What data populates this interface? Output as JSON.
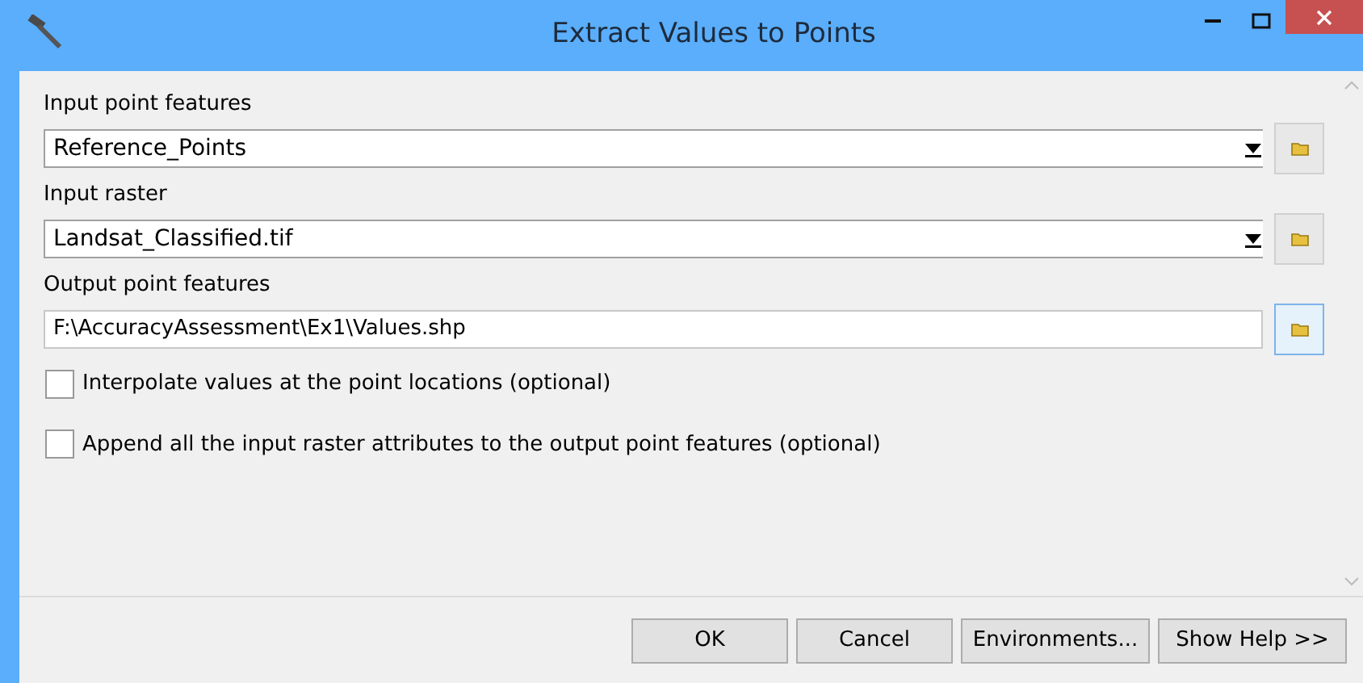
{
  "window": {
    "title": "Extract Values to Points"
  },
  "parameters": [
    {
      "label": "Input point features",
      "kind": "dropdown",
      "value": "Reference_Points",
      "focused": false
    },
    {
      "label": "Input raster",
      "kind": "dropdown",
      "value": "Landsat_Classified.tif",
      "focused": false
    },
    {
      "label": "Output point features",
      "kind": "text",
      "value": "F:\\AccuracyAssessment\\Ex1\\Values.shp",
      "focused": true
    }
  ],
  "options": [
    {
      "label": "Interpolate values at the point locations (optional)",
      "checked": false
    },
    {
      "label": "Append all the input raster attributes to the output point features (optional)",
      "checked": false
    }
  ],
  "buttons": [
    "OK",
    "Cancel",
    "Environments...",
    "Show Help >>"
  ]
}
